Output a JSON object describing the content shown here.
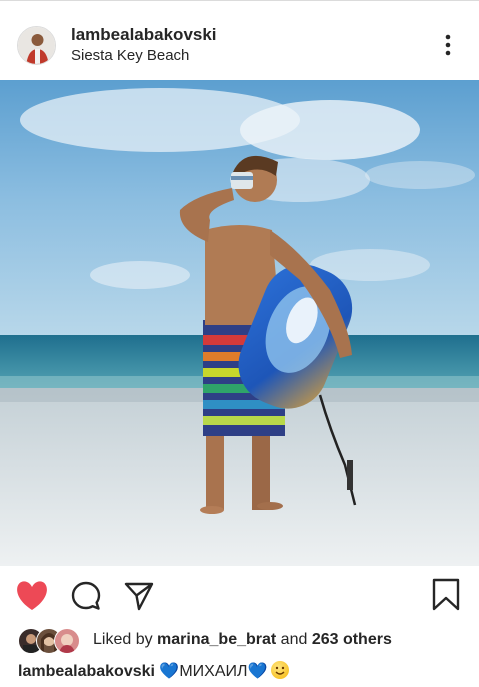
{
  "post": {
    "username": "lambealabakovski",
    "location": "Siesta Key Beach"
  },
  "likes": {
    "prefix": "Liked by ",
    "user": "marina_be_brat",
    "middle": " and ",
    "count_text": "263 others"
  },
  "caption": {
    "username": "lambealabakovski",
    "text": "💙МИХАИЛ💙"
  },
  "icons": {
    "like": "heart-filled-icon",
    "comment": "comment-icon",
    "share": "paper-plane-icon",
    "save": "bookmark-icon",
    "more": "more-vertical-icon",
    "caption_emoji": "smiling-face-icon"
  },
  "colors": {
    "like_red": "#ed4956",
    "text": "#262626"
  }
}
